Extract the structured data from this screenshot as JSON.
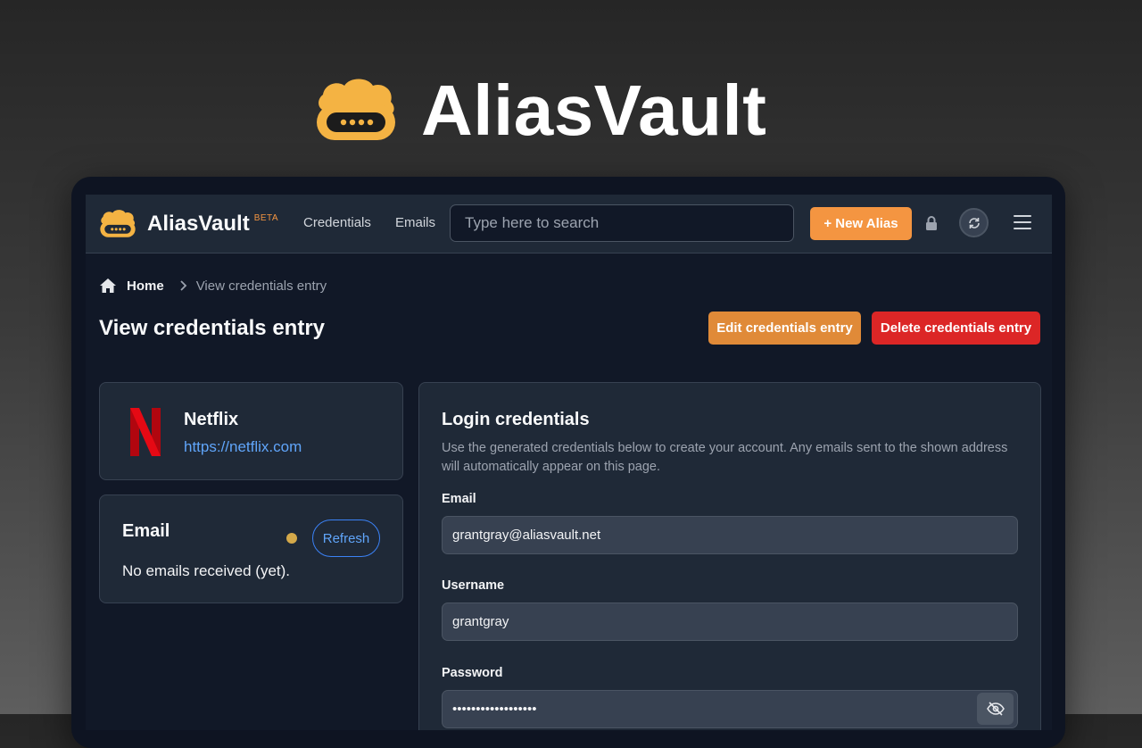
{
  "hero": {
    "title": "AliasVault"
  },
  "navbar": {
    "brand": "AliasVault",
    "beta": "BETA",
    "links": [
      "Credentials",
      "Emails"
    ],
    "search_placeholder": "Type here to search",
    "new_alias_label": "+ New Alias"
  },
  "breadcrumb": {
    "home": "Home",
    "current": "View credentials entry"
  },
  "page": {
    "title": "View credentials entry",
    "edit_label": "Edit credentials entry",
    "delete_label": "Delete credentials entry"
  },
  "service": {
    "name": "Netflix",
    "url": "https://netflix.com"
  },
  "email_card": {
    "title": "Email",
    "refresh_label": "Refresh",
    "empty_text": "No emails received (yet)."
  },
  "login": {
    "title": "Login credentials",
    "description": "Use the generated credentials below to create your account. Any emails sent to the shown address will automatically appear on this page.",
    "email_label": "Email",
    "email_value": "grantgray@aliasvault.net",
    "username_label": "Username",
    "username_value": "grantgray",
    "password_label": "Password",
    "password_value": "••••••••••••••••••"
  },
  "colors": {
    "accent": "#f49541",
    "danger": "#dc2626",
    "link": "#60a5fa",
    "background": "#111827",
    "card": "#1f2937"
  },
  "icons": [
    "aliasvault-logo-icon",
    "home-icon",
    "chevron-right-icon",
    "lock-icon",
    "sync-icon",
    "hamburger-menu-icon",
    "netflix-logo-icon",
    "eye-off-icon"
  ]
}
